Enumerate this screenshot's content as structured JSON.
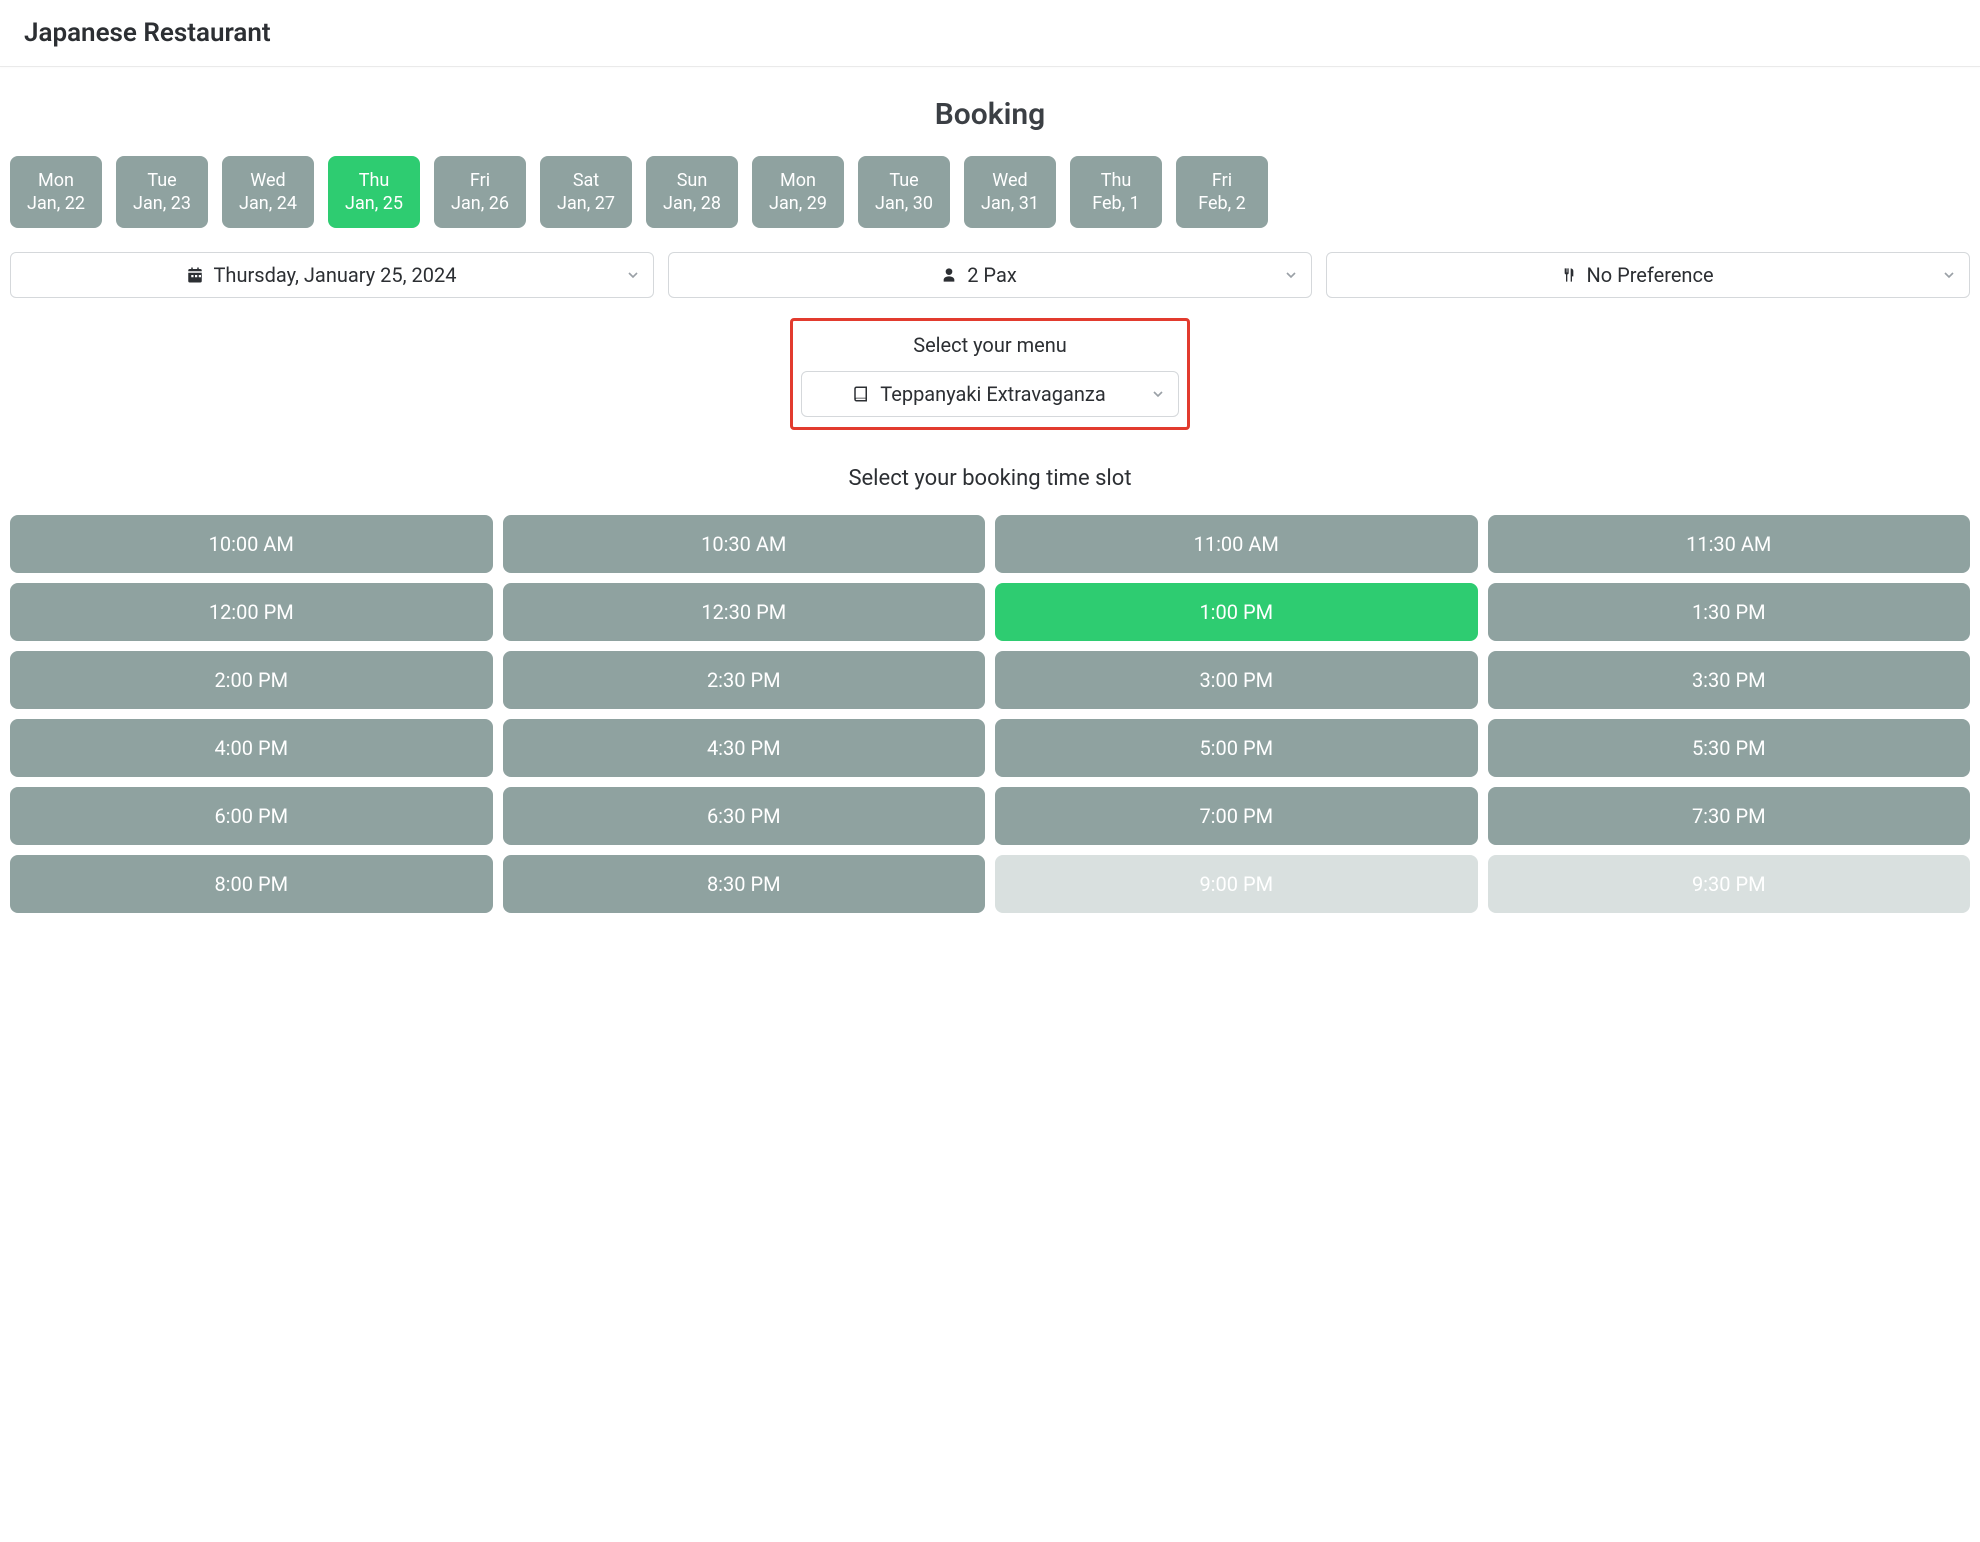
{
  "header": {
    "title": "Japanese Restaurant"
  },
  "booking": {
    "title": "Booking",
    "dates": [
      {
        "dow": "Mon",
        "md": "Jan, 22",
        "selected": false
      },
      {
        "dow": "Tue",
        "md": "Jan, 23",
        "selected": false
      },
      {
        "dow": "Wed",
        "md": "Jan, 24",
        "selected": false
      },
      {
        "dow": "Thu",
        "md": "Jan, 25",
        "selected": true
      },
      {
        "dow": "Fri",
        "md": "Jan, 26",
        "selected": false
      },
      {
        "dow": "Sat",
        "md": "Jan, 27",
        "selected": false
      },
      {
        "dow": "Sun",
        "md": "Jan, 28",
        "selected": false
      },
      {
        "dow": "Mon",
        "md": "Jan, 29",
        "selected": false
      },
      {
        "dow": "Tue",
        "md": "Jan, 30",
        "selected": false
      },
      {
        "dow": "Wed",
        "md": "Jan, 31",
        "selected": false
      },
      {
        "dow": "Thu",
        "md": "Feb, 1",
        "selected": false
      },
      {
        "dow": "Fri",
        "md": "Feb, 2",
        "selected": false
      }
    ],
    "date_select": "Thursday, January 25, 2024",
    "pax_select": "2 Pax",
    "pref_select": "No Preference",
    "menu_section_label": "Select your menu",
    "menu_select": "Teppanyaki Extravaganza",
    "timeslot_title": "Select your booking time slot",
    "timeslots": [
      {
        "t": "10:00 AM",
        "state": "avail"
      },
      {
        "t": "10:30 AM",
        "state": "avail"
      },
      {
        "t": "11:00 AM",
        "state": "avail"
      },
      {
        "t": "11:30 AM",
        "state": "avail"
      },
      {
        "t": "12:00 PM",
        "state": "avail"
      },
      {
        "t": "12:30 PM",
        "state": "avail"
      },
      {
        "t": "1:00 PM",
        "state": "selected"
      },
      {
        "t": "1:30 PM",
        "state": "avail"
      },
      {
        "t": "2:00 PM",
        "state": "avail"
      },
      {
        "t": "2:30 PM",
        "state": "avail"
      },
      {
        "t": "3:00 PM",
        "state": "avail"
      },
      {
        "t": "3:30 PM",
        "state": "avail"
      },
      {
        "t": "4:00 PM",
        "state": "avail"
      },
      {
        "t": "4:30 PM",
        "state": "avail"
      },
      {
        "t": "5:00 PM",
        "state": "avail"
      },
      {
        "t": "5:30 PM",
        "state": "avail"
      },
      {
        "t": "6:00 PM",
        "state": "avail"
      },
      {
        "t": "6:30 PM",
        "state": "avail"
      },
      {
        "t": "7:00 PM",
        "state": "avail"
      },
      {
        "t": "7:30 PM",
        "state": "avail"
      },
      {
        "t": "8:00 PM",
        "state": "avail"
      },
      {
        "t": "8:30 PM",
        "state": "avail"
      },
      {
        "t": "9:00 PM",
        "state": "disabled"
      },
      {
        "t": "9:30 PM",
        "state": "disabled"
      }
    ]
  }
}
